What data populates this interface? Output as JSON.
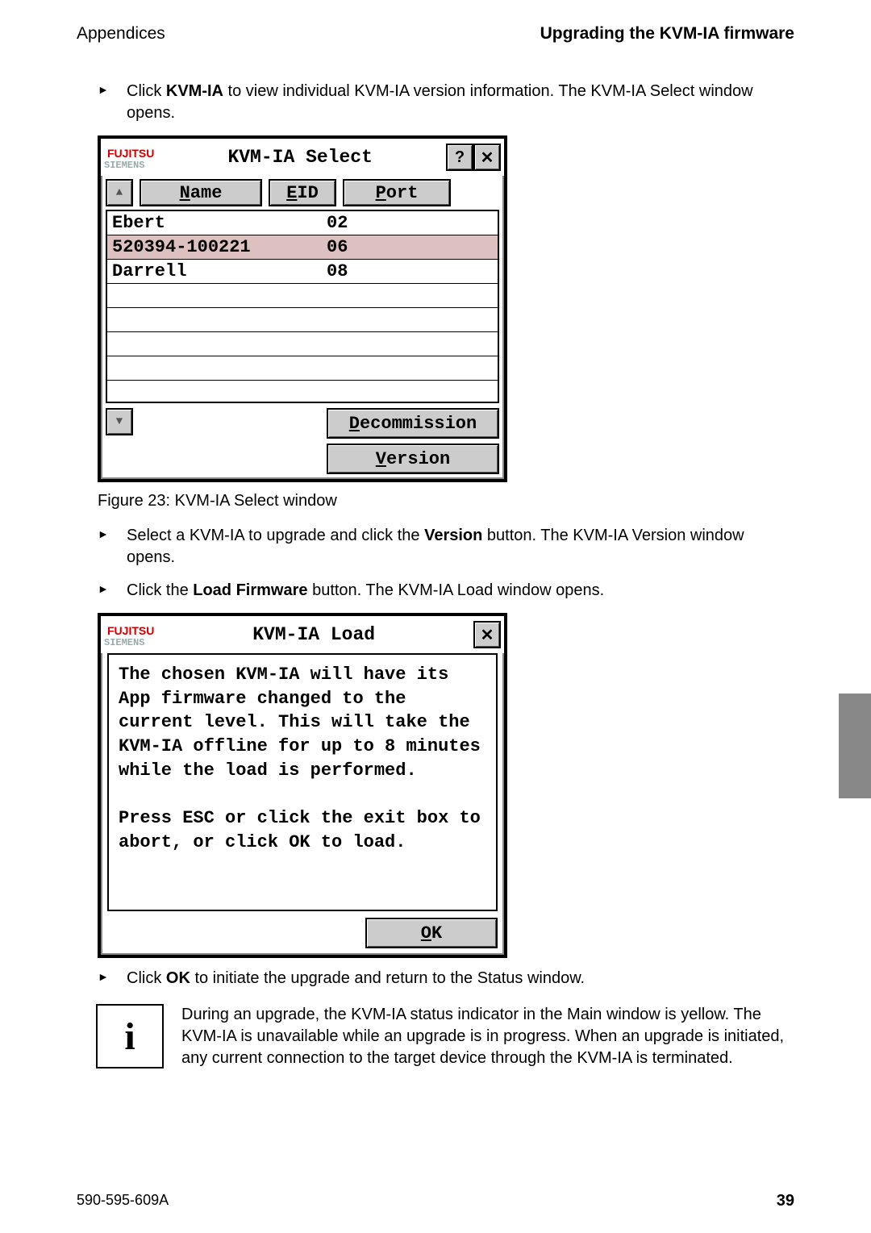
{
  "header": {
    "left": "Appendices",
    "right": "Upgrading the KVM-IA firmware"
  },
  "step1": {
    "pre": "Click ",
    "bold": "KVM-IA",
    "post": " to view individual KVM-IA version information. The KVM-IA Select window opens."
  },
  "select_window": {
    "brand": "FUJITSU",
    "brand2": "SIEMENS",
    "title": "KVM-IA Select",
    "help": "?",
    "close": "✕",
    "cols": {
      "name": "Name",
      "eid": "EID",
      "port": "Port"
    },
    "rows": [
      {
        "name": "Ebert",
        "port": "02",
        "selected": false
      },
      {
        "name": "520394-100221",
        "port": "06",
        "selected": true
      },
      {
        "name": "Darrell",
        "port": "08",
        "selected": false
      }
    ],
    "decommission": "Decommission",
    "version": "Version"
  },
  "figure_caption": "Figure 23: KVM-IA Select window",
  "step2": {
    "pre": "Select a KVM-IA to upgrade and click the ",
    "bold": "Version",
    "post": " button. The KVM-IA Version window opens."
  },
  "step3": {
    "pre": "Click the ",
    "bold": "Load Firmware",
    "post": " button. The KVM-IA Load window opens."
  },
  "load_window": {
    "brand": "FUJITSU",
    "brand2": "SIEMENS",
    "title": "KVM-IA Load",
    "close": "✕",
    "body": "The chosen KVM-IA will have its App firmware changed to the current level. This will take the KVM-IA offline for up to 8 minutes while the load is performed.\n\nPress ESC or click the exit box to abort, or click OK to load.",
    "ok": "OK"
  },
  "step4": {
    "pre": "Click ",
    "bold": "OK",
    "post": " to initiate the upgrade and return to the Status window."
  },
  "info": {
    "glyph": "i",
    "text": "During an upgrade, the KVM-IA status indicator in the Main window is yellow. The KVM-IA is unavailable while an upgrade is in progress. When an upgrade is initiated, any current connection to the target device through the KVM-IA is terminated."
  },
  "footer": {
    "left": "590-595-609A",
    "right": "39"
  }
}
